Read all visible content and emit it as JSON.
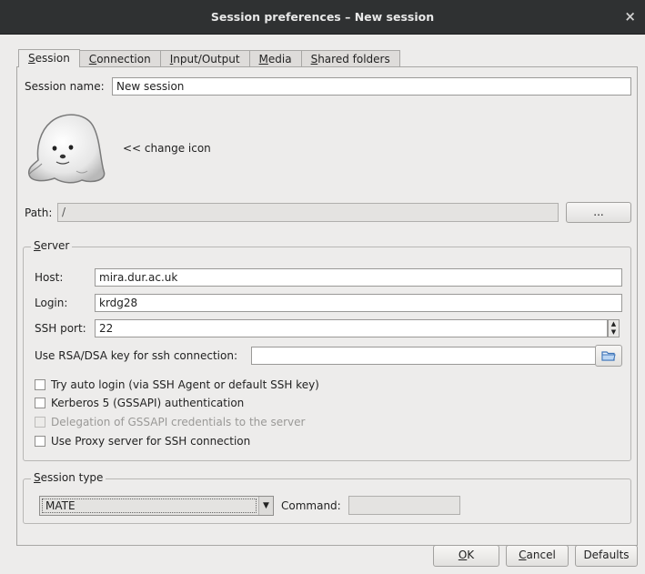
{
  "window": {
    "title": "Session preferences – New session",
    "close_glyph": "×"
  },
  "tabs": [
    {
      "mnemonic": "S",
      "rest": "ession"
    },
    {
      "mnemonic": "C",
      "rest": "onnection"
    },
    {
      "mnemonic": "I",
      "rest": "nput/Output"
    },
    {
      "mnemonic": "M",
      "rest": "edia"
    },
    {
      "mnemonic": "S",
      "rest": "hared folders"
    }
  ],
  "session": {
    "name_label": "Session name:",
    "name_value": "New session",
    "change_icon_label": "<< change icon",
    "icon": "seal-icon"
  },
  "path": {
    "label": "Path:",
    "value": "/",
    "browse_label": "..."
  },
  "server": {
    "group_title_mnemonic": "S",
    "group_title_rest": "erver",
    "host_label": "Host:",
    "host_value": "mira.dur.ac.uk",
    "login_label": "Login:",
    "login_value": "krdg28",
    "port_label": "SSH port:",
    "port_value": "22",
    "rsa_label": "Use RSA/DSA key for ssh connection:",
    "rsa_value": "",
    "folder_icon": "folder-open-icon"
  },
  "checkboxes": [
    {
      "label": "Try auto login (via SSH Agent or default SSH key)",
      "checked": false,
      "disabled": false
    },
    {
      "label": "Kerberos 5 (GSSAPI) authentication",
      "checked": false,
      "disabled": false
    },
    {
      "label": "Delegation of GSSAPI credentials to the server",
      "checked": false,
      "disabled": true
    },
    {
      "label": "Use Proxy server for SSH connection",
      "checked": false,
      "disabled": false
    }
  ],
  "session_type": {
    "group_title_mnemonic": "S",
    "group_title_rest": "ession type",
    "selected": "MATE",
    "command_label": "Command:",
    "command_value": ""
  },
  "buttons": {
    "ok_mnemonic": "O",
    "ok_rest": "K",
    "cancel_mnemonic": "C",
    "cancel_rest": "ancel",
    "defaults": "Defaults"
  }
}
